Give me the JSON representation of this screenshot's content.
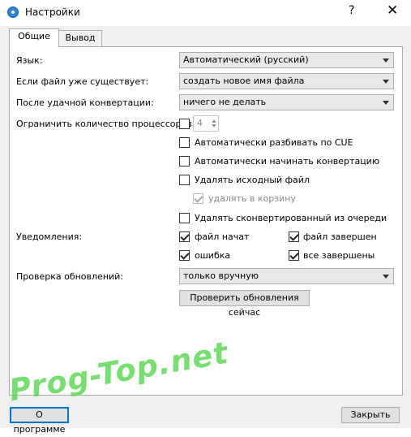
{
  "window": {
    "title": "Настройки",
    "help": "?",
    "close": "✕"
  },
  "tabs": [
    {
      "label": "Общие"
    },
    {
      "label": "Вывод"
    }
  ],
  "general": {
    "language": {
      "label": "Язык:",
      "value": "Автоматический (русский)"
    },
    "file_exists": {
      "label": "Если файл уже существует:",
      "value": "создать новое имя файла"
    },
    "after_success": {
      "label": "После удачной конвертации:",
      "value": "ничего не делать"
    },
    "limit_cpu": {
      "label": "Ограничить количество процессоров:",
      "value": "4"
    },
    "auto_split_cue": {
      "label": "Автоматически разбивать по CUE"
    },
    "auto_start": {
      "label": "Автоматически начинать конвертацию"
    },
    "delete_source": {
      "label": "Удалять исходный файл"
    },
    "to_recycle": {
      "label": "удалять в корзину"
    },
    "remove_converted": {
      "label": "Удалять сконвертированный из очереди"
    },
    "notifications": {
      "label": "Уведомления:",
      "file_started": "файл начат",
      "file_finished": "файл завершен",
      "error": "ошибка",
      "all_finished": "все завершены"
    },
    "updates": {
      "label": "Проверка обновлений:",
      "value": "только вручную",
      "check_now": "Проверить обновления сейчас"
    }
  },
  "footer": {
    "about": "О программе",
    "close": "Закрыть"
  },
  "watermark": "Prog-Top.net"
}
